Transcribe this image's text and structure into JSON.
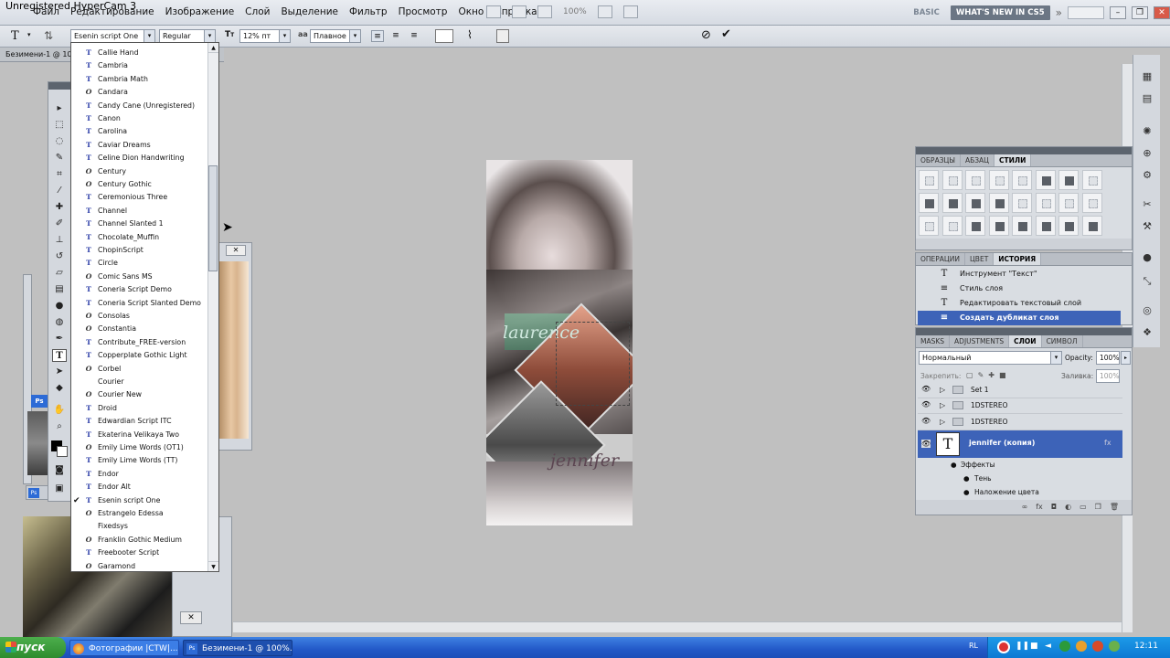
{
  "recorder_caption": "Unregistered HyperCam 3",
  "menu": [
    "Файл",
    "Редактирование",
    "Изображение",
    "Слой",
    "Выделение",
    "Фильтр",
    "Просмотр",
    "Окно",
    "Справка"
  ],
  "zoom_value": "100%",
  "workspace": {
    "basic": "BASIC",
    "whats_new": "WHAT'S NEW IN CS5"
  },
  "options": {
    "font_family": "Esenin script One",
    "font_style": "Regular",
    "font_size": "12% пт",
    "antialias": "Плавное"
  },
  "doc_tab": "Безимени-1 @ 10",
  "font_list": [
    {
      "name": "Callie Hand",
      "icon": "tt"
    },
    {
      "name": "Cambria",
      "icon": "tt"
    },
    {
      "name": "Cambria Math",
      "icon": "tt"
    },
    {
      "name": "Candara",
      "icon": "ot"
    },
    {
      "name": "Candy Cane (Unregistered)",
      "icon": "tt"
    },
    {
      "name": "Canon",
      "icon": "tt"
    },
    {
      "name": "Carolina",
      "icon": "tt"
    },
    {
      "name": "Caviar Dreams",
      "icon": "tt"
    },
    {
      "name": "Celine Dion Handwriting",
      "icon": "tt"
    },
    {
      "name": "Century",
      "icon": "ot"
    },
    {
      "name": "Century Gothic",
      "icon": "ot"
    },
    {
      "name": "Ceremonious Three",
      "icon": "tt"
    },
    {
      "name": "Channel",
      "icon": "tt"
    },
    {
      "name": "Channel Slanted 1",
      "icon": "tt"
    },
    {
      "name": "Chocolate_Muffin",
      "icon": "tt"
    },
    {
      "name": "ChopinScript",
      "icon": "tt"
    },
    {
      "name": "Circle",
      "icon": "tt"
    },
    {
      "name": "Comic Sans MS",
      "icon": "ot"
    },
    {
      "name": "Coneria Script Demo",
      "icon": "tt"
    },
    {
      "name": "Coneria Script Slanted Demo",
      "icon": "tt"
    },
    {
      "name": "Consolas",
      "icon": "ot"
    },
    {
      "name": "Constantia",
      "icon": "ot"
    },
    {
      "name": "Contribute_FREE-version",
      "icon": "tt"
    },
    {
      "name": "Copperplate Gothic Light",
      "icon": "tt"
    },
    {
      "name": "Corbel",
      "icon": "ot"
    },
    {
      "name": "Courier",
      "icon": "none"
    },
    {
      "name": "Courier New",
      "icon": "ot"
    },
    {
      "name": "Droid",
      "icon": "tt"
    },
    {
      "name": "Edwardian Script ITC",
      "icon": "tt"
    },
    {
      "name": "Ekaterina Velikaya Two",
      "icon": "tt"
    },
    {
      "name": "Emily Lime Words (OT1)",
      "icon": "ot"
    },
    {
      "name": "Emily Lime Words (TT)",
      "icon": "tt"
    },
    {
      "name": "Endor",
      "icon": "tt"
    },
    {
      "name": "Endor Alt",
      "icon": "tt"
    },
    {
      "name": "Esenin script One",
      "icon": "tt",
      "checked": true
    },
    {
      "name": "Estrangelo Edessa",
      "icon": "ot"
    },
    {
      "name": "Fixedsys",
      "icon": "none"
    },
    {
      "name": "Franklin Gothic Medium",
      "icon": "ot"
    },
    {
      "name": "Freebooter Script",
      "icon": "tt"
    },
    {
      "name": "Garamond",
      "icon": "ot"
    }
  ],
  "canvas_text": {
    "top": "laurence",
    "bottom": "jennifer"
  },
  "panel_styles": {
    "tabs": [
      "ОБРАЗЦЫ",
      "АБЗАЦ",
      "СТИЛИ"
    ]
  },
  "panel_history": {
    "tabs": [
      "ОПЕРАЦИИ",
      "ЦВЕТ",
      "ИСТОРИЯ"
    ],
    "items": [
      {
        "label": "Инструмент \"Текст\"",
        "icon": "T"
      },
      {
        "label": "Стиль слоя",
        "icon": "≡"
      },
      {
        "label": "Редактировать текстовый слой",
        "icon": "T"
      },
      {
        "label": "Создать дубликат слоя",
        "icon": "≡",
        "selected": true
      }
    ]
  },
  "panel_layers": {
    "tabs": [
      "MASKS",
      "ADJUSTMENTS",
      "СЛОИ",
      "СИМВОЛ"
    ],
    "blend_mode": "Нормальный",
    "opacity_label": "Opacity:",
    "opacity_value": "100%",
    "lock_label": "Закрепить:",
    "fill_label": "Заливка:",
    "fill_value": "100%",
    "layers": [
      {
        "name": "Set 1",
        "type": "folder"
      },
      {
        "name": "1DSTEREO",
        "type": "folder"
      },
      {
        "name": "1DSTEREO",
        "type": "folder"
      },
      {
        "name": "jennifer (копия)",
        "type": "text",
        "selected": true
      }
    ],
    "effects_label": "Эффекты",
    "effects": [
      "Тень",
      "Наложение цвета"
    ]
  },
  "taskbar": {
    "start": "пуск",
    "items": [
      "Фотографии |CTW|...",
      "Безимени-1 @ 100%..."
    ],
    "lang": "RL",
    "clock": "12:11"
  }
}
